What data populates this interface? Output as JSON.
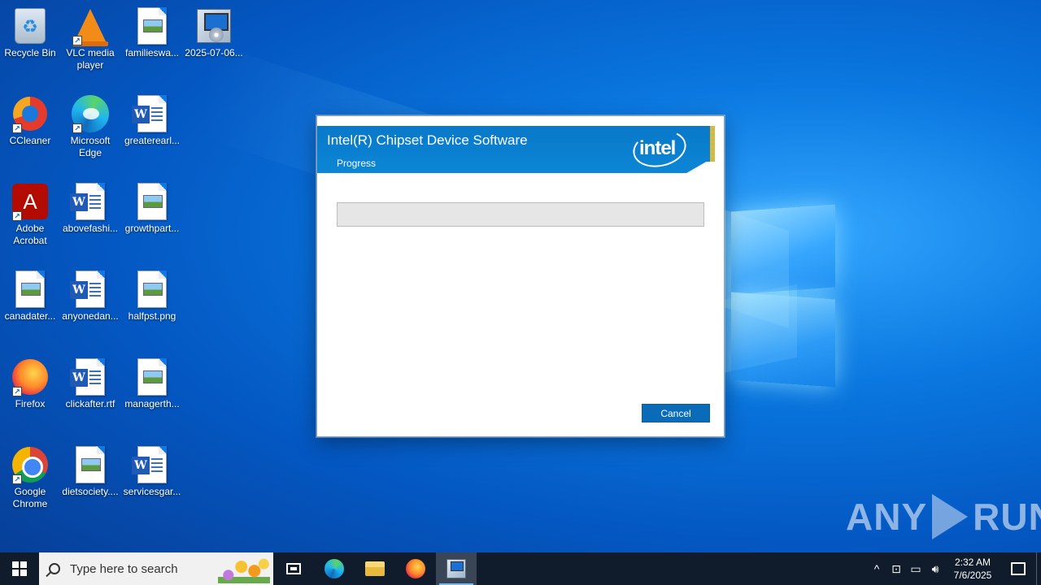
{
  "desktop": {
    "icons": [
      {
        "label": "Recycle Bin",
        "icon": "recycle-bin-icon"
      },
      {
        "label": "VLC media player",
        "icon": "vlc-icon"
      },
      {
        "label": "familieswa...",
        "icon": "image-file-icon"
      },
      {
        "label": "2025-07-06...",
        "icon": "installer-icon"
      },
      {
        "label": "CCleaner",
        "icon": "ccleaner-icon"
      },
      {
        "label": "Microsoft Edge",
        "icon": "edge-icon"
      },
      {
        "label": "greaterearl...",
        "icon": "word-doc-icon"
      },
      {
        "label": "Adobe Acrobat",
        "icon": "acrobat-icon"
      },
      {
        "label": "abovefashi...",
        "icon": "word-doc-icon"
      },
      {
        "label": "growthpart...",
        "icon": "image-file-icon"
      },
      {
        "label": "canadater...",
        "icon": "image-file-icon"
      },
      {
        "label": "anyonedan...",
        "icon": "word-doc-icon"
      },
      {
        "label": "halfpst.png",
        "icon": "image-file-icon"
      },
      {
        "label": "Firefox",
        "icon": "firefox-icon"
      },
      {
        "label": "clickafter.rtf",
        "icon": "word-doc-icon"
      },
      {
        "label": "managerth...",
        "icon": "image-file-icon"
      },
      {
        "label": "Google Chrome",
        "icon": "chrome-icon"
      },
      {
        "label": "dietsociety....",
        "icon": "image-file-icon"
      },
      {
        "label": "servicesgar...",
        "icon": "word-doc-icon"
      }
    ]
  },
  "dialog": {
    "title": "Intel(R) Chipset Device Software",
    "subtitle": "Progress",
    "logo_text": "intel",
    "progress_fraction": 0,
    "cancel_label": "Cancel"
  },
  "watermark": {
    "left": "ANY",
    "right": "RUN"
  },
  "taskbar": {
    "search_placeholder": "Type here to search",
    "time": "2:32 AM",
    "date": "7/6/2025",
    "tray_chevron": "^"
  },
  "colors": {
    "banner_blue": "#0a78c8",
    "button_blue": "#0a6cb8",
    "taskbar_bg": "#101c2c"
  }
}
